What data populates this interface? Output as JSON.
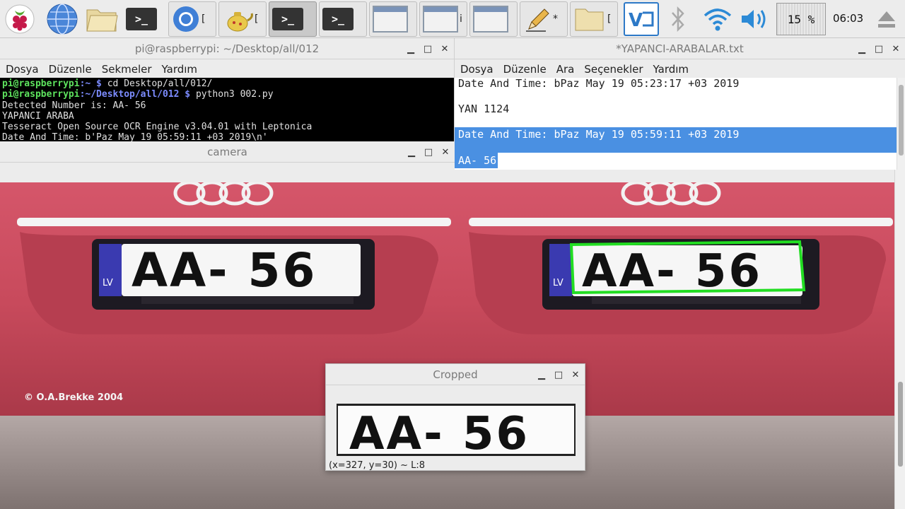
{
  "taskbar": {
    "tasks": [
      {
        "label": "[",
        "name": "task-chromium"
      },
      {
        "label": "[",
        "name": "task-thonny"
      },
      {
        "label": "",
        "name": "task-terminal-1"
      },
      {
        "label": "",
        "name": "task-terminal-2"
      },
      {
        "label": "",
        "name": "task-window-1"
      },
      {
        "label": "i",
        "name": "task-window-2"
      },
      {
        "label": "",
        "name": "task-window-3"
      },
      {
        "label": "*",
        "name": "task-text-editor"
      },
      {
        "label": "[",
        "name": "task-file-manager"
      }
    ],
    "terminal_glyph": ">_",
    "cpu": "15 %",
    "clock": "06:03"
  },
  "terminal": {
    "title": "pi@raspberrypi: ~/Desktop/all/012",
    "menu": [
      "Dosya",
      "Düzenle",
      "Sekmeler",
      "Yardım"
    ],
    "lines": [
      {
        "user": "pi@raspberrypi",
        "path": ":~ $",
        "cmd": " cd Desktop/all/012/"
      },
      {
        "user": "pi@raspberrypi",
        "path": ":~/Desktop/all/012 $",
        "cmd": " python3 002.py"
      }
    ],
    "output": [
      "Detected Number is: AA- 56",
      "YAPANCI ARABA",
      "Tesseract Open Source OCR Engine v3.04.01 with Leptonica",
      "Date And Time: b'Paz May 19 05:59:11 +03 2019\\n'"
    ]
  },
  "editor": {
    "title": "*YAPANCI-ARABALAR.txt",
    "menu": [
      "Dosya",
      "Düzenle",
      "Ara",
      "Seçenekler",
      "Yardım"
    ],
    "lines": [
      "Date And Time: bPaz May 19 05:23:17 +03 2019",
      "YAN 1124",
      "Date And Time: bPaz May 19 05:59:11 +03 2019",
      "AA- 56"
    ]
  },
  "camera": {
    "title": "camera",
    "plate": "AA- 56",
    "country": "LV",
    "watermark": "© O.A.Brekke 2004"
  },
  "right_view": {
    "plate": "AA- 56",
    "country": "LV"
  },
  "cropped": {
    "title": "Cropped",
    "plate": "AA- 56",
    "status": "(x=327, y=30) ~ L:8"
  },
  "colors": {
    "selection": "#4a90e2",
    "prompt_user": "#5ee35e",
    "prompt_path": "#7c8cff",
    "detect_box": "#22dd22",
    "car_body": "#c8485a"
  }
}
